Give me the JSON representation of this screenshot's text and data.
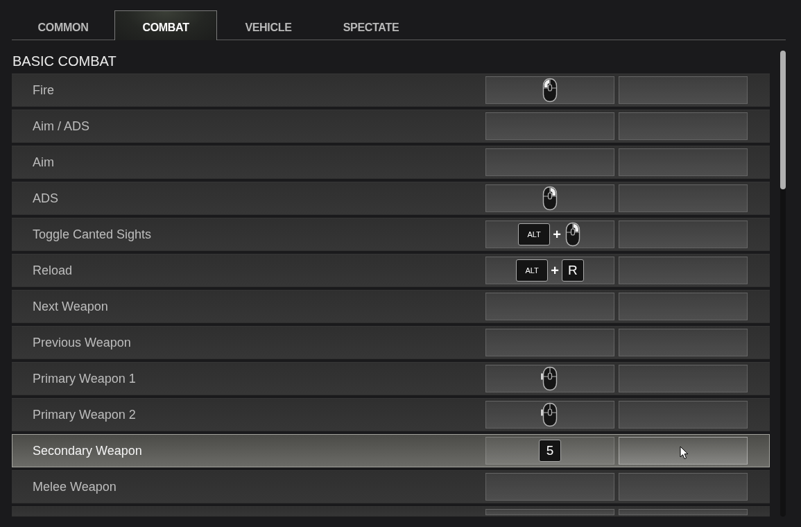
{
  "tabs": [
    {
      "label": "COMMON",
      "selected": false
    },
    {
      "label": "COMBAT",
      "selected": true
    },
    {
      "label": "VEHICLE",
      "selected": false
    },
    {
      "label": "SPECTATE",
      "selected": false
    }
  ],
  "section": {
    "title": "BASIC COMBAT"
  },
  "rows": [
    {
      "label": "Fire",
      "selected": false,
      "bindings": [
        {
          "hovered": false,
          "keys": [
            {
              "kind": "mouse",
              "left": true,
              "right": false,
              "side": false
            }
          ]
        },
        {
          "hovered": false
        }
      ]
    },
    {
      "label": "Aim / ADS",
      "selected": false,
      "bindings": [
        {
          "hovered": false
        },
        {
          "hovered": false
        }
      ]
    },
    {
      "label": "Aim",
      "selected": false,
      "bindings": [
        {
          "hovered": false
        },
        {
          "hovered": false
        }
      ]
    },
    {
      "label": "ADS",
      "selected": false,
      "bindings": [
        {
          "hovered": false,
          "keys": [
            {
              "kind": "mouse",
              "left": false,
              "right": true,
              "side": false
            }
          ]
        },
        {
          "hovered": false
        }
      ]
    },
    {
      "label": "Toggle Canted Sights",
      "selected": false,
      "bindings": [
        {
          "hovered": false,
          "keys": [
            {
              "kind": "key",
              "label": "ALT"
            },
            {
              "kind": "plus",
              "text": "+"
            },
            {
              "kind": "mouse",
              "left": false,
              "right": true,
              "side": false
            }
          ]
        },
        {
          "hovered": false
        }
      ]
    },
    {
      "label": "Reload",
      "selected": false,
      "bindings": [
        {
          "hovered": false,
          "keys": [
            {
              "kind": "key",
              "label": "ALT"
            },
            {
              "kind": "plus",
              "text": "+"
            },
            {
              "kind": "key",
              "label": "R"
            }
          ]
        },
        {
          "hovered": false
        }
      ]
    },
    {
      "label": "Next Weapon",
      "selected": false,
      "bindings": [
        {
          "hovered": false
        },
        {
          "hovered": false
        }
      ]
    },
    {
      "label": "Previous Weapon",
      "selected": false,
      "bindings": [
        {
          "hovered": false
        },
        {
          "hovered": false
        }
      ]
    },
    {
      "label": "Primary Weapon 1",
      "selected": false,
      "bindings": [
        {
          "hovered": false,
          "keys": [
            {
              "kind": "mouse",
              "left": false,
              "right": false,
              "side": true
            }
          ]
        },
        {
          "hovered": false
        }
      ]
    },
    {
      "label": "Primary Weapon 2",
      "selected": false,
      "bindings": [
        {
          "hovered": false,
          "keys": [
            {
              "kind": "mouse",
              "left": false,
              "right": false,
              "side": true
            }
          ]
        },
        {
          "hovered": false
        }
      ]
    },
    {
      "label": "Secondary Weapon",
      "selected": true,
      "bindings": [
        {
          "hovered": false,
          "keys": [
            {
              "kind": "key",
              "label": "5"
            }
          ]
        },
        {
          "hovered": true
        }
      ]
    },
    {
      "label": "Melee Weapon",
      "selected": false,
      "bindings": [
        {
          "hovered": false
        },
        {
          "hovered": false
        }
      ]
    },
    {
      "selected": false,
      "bindings": [
        {
          "hovered": false
        },
        {
          "hovered": false
        }
      ]
    }
  ]
}
